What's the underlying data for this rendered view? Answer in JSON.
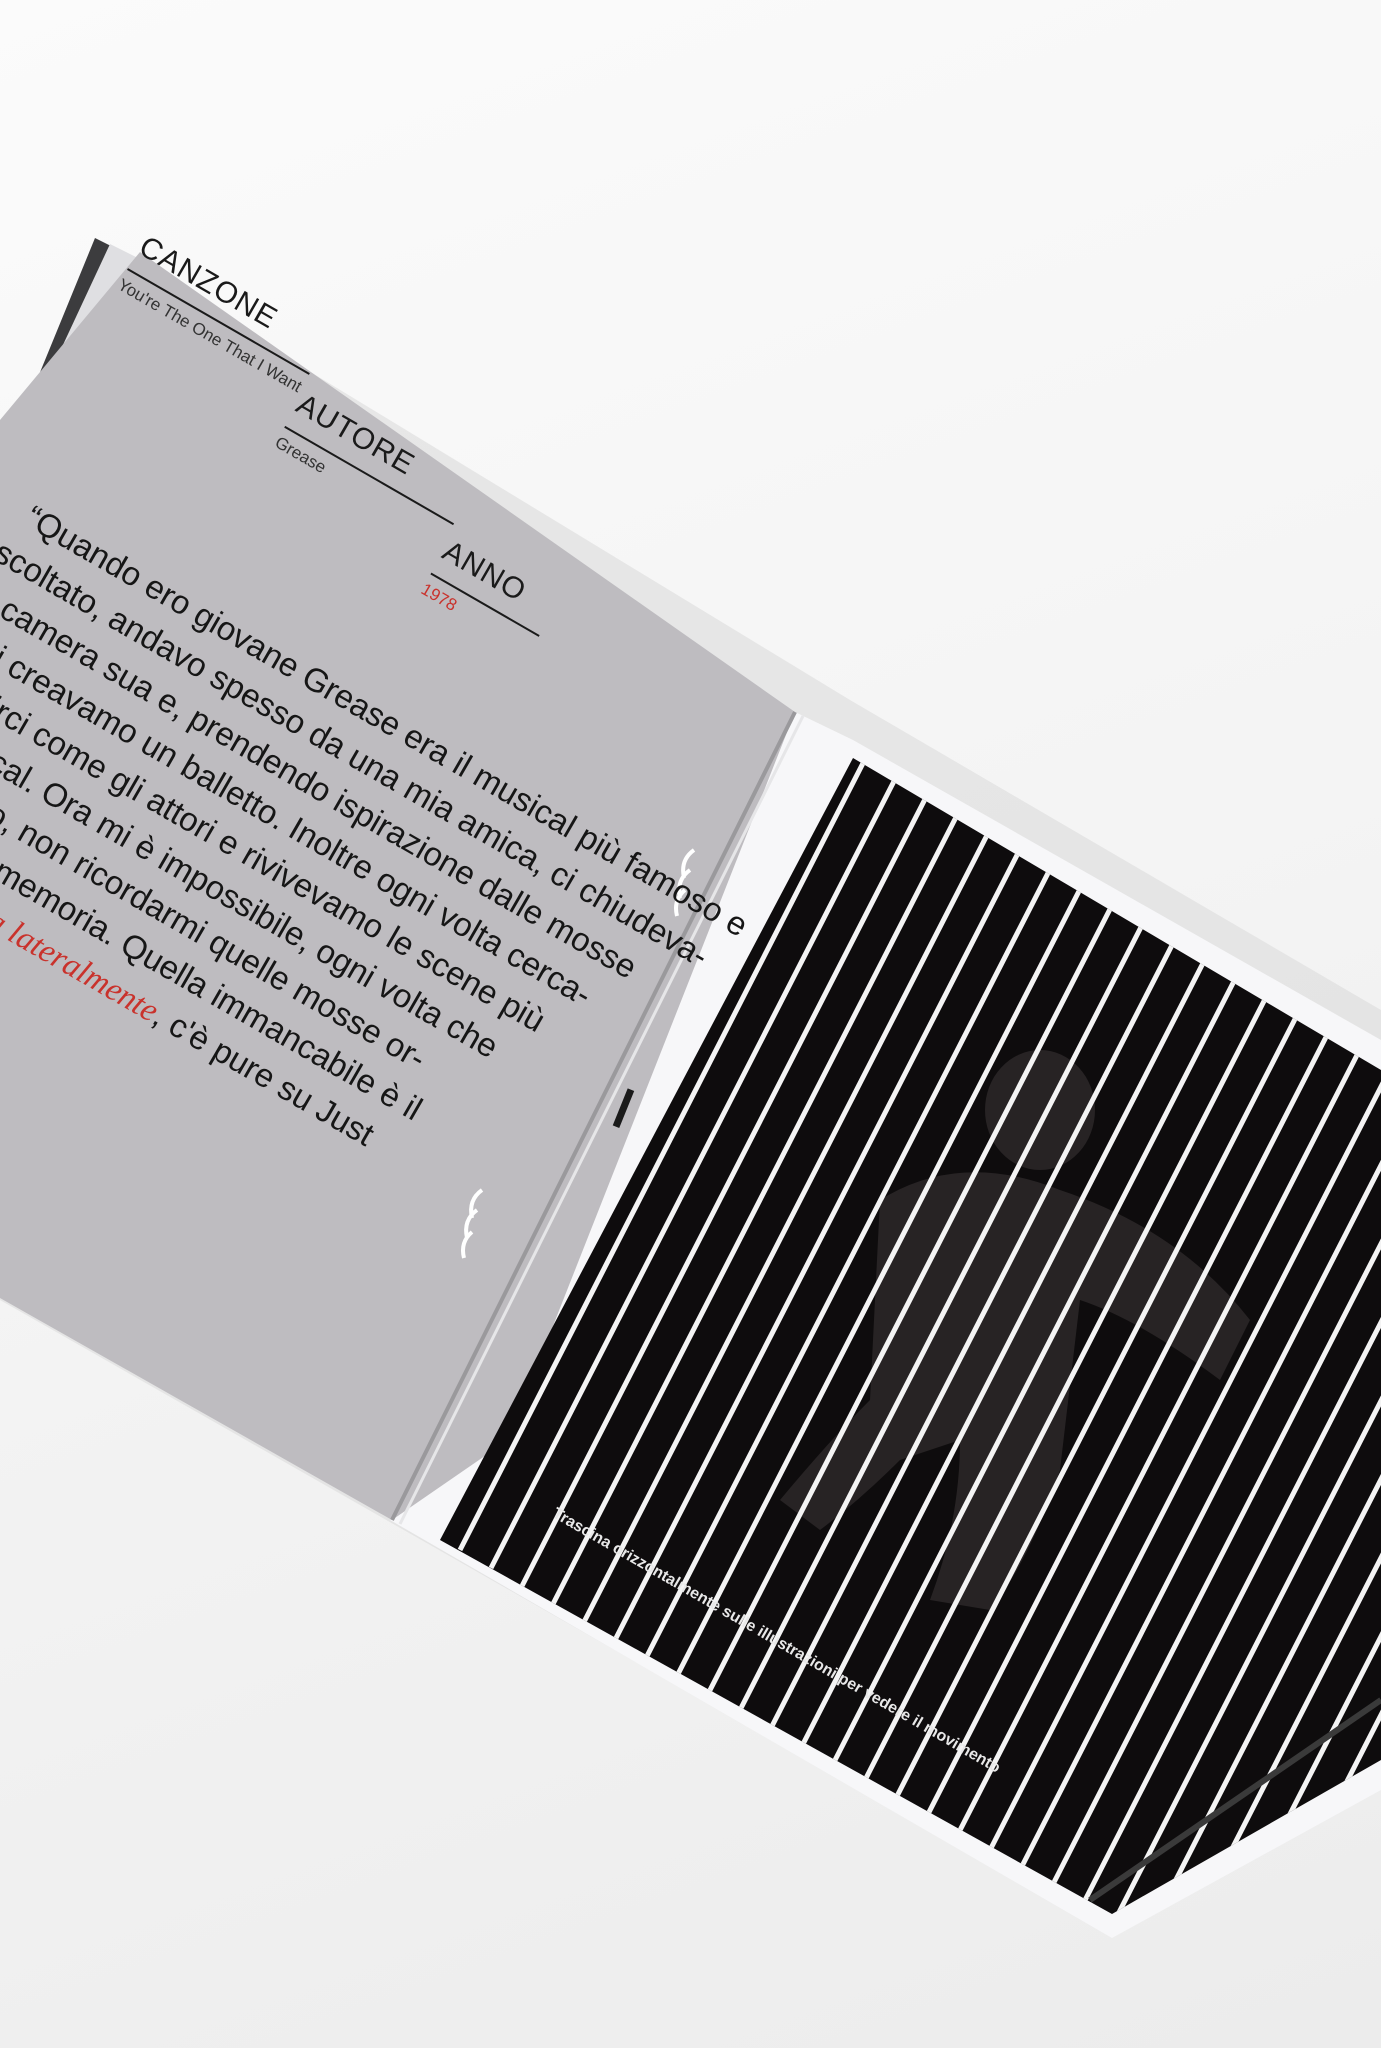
{
  "left_page": {
    "labels": {
      "canzone": "CANZONE",
      "canzone_value": "You're The One That I Want",
      "autore": "AUTORE",
      "autore_value": "Grease",
      "anno": "ANNO",
      "anno_value": "1978"
    },
    "body_lines": [
      "“Quando ero giovane Grease era il musical più famoso e",
      "ascoltato, andavo spesso da una mia amica, ci chiudeva-",
      "mo in camera sua e, prendendo ispirazione dalle mosse",
      "l film, ci creavamo un balletto. Inoltre ogni volta cerca-",
      "o di vestirci come gli attori e rivivevamo le scene più",
      "ri del musical. Ora mi è impossibile, ogni volta che",
      "questo brano, non ricordarmi quelle mosse or-",
      "ebili nella mia memoria. Quella immancabile è il"
    ],
    "last_line": {
      "emphasis": "di spalle e braccia lateralmente",
      "rest": ", c'è pure su Just"
    }
  },
  "right_page": {
    "caption": "Trascina orizzontalmente sulle illustrazioni per vedere il movimento"
  },
  "colors": {
    "background": "#f5f5f5",
    "left_page_paper": "#bebcc0",
    "right_page_paper": "#f7f7f9",
    "panel_black": "#0e0c0d",
    "stripe_white": "#f4f4f4",
    "accent_red": "#c9322c"
  }
}
